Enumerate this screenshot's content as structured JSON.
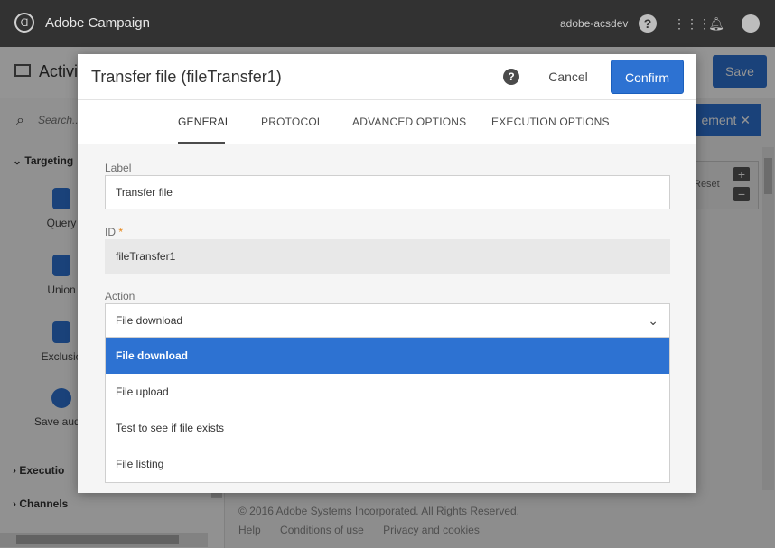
{
  "topbar": {
    "app_name": "Adobe Campaign",
    "user": "adobe-acsdev",
    "icons": [
      "adobe-logo-icon",
      "help-icon",
      "apps-grid-icon",
      "bell-icon",
      "avatar-icon"
    ]
  },
  "background": {
    "activity_title": "Activi",
    "save_label": "Save",
    "search_placeholder": "Search...",
    "categories": {
      "targeting": "Targeting",
      "execution": "Executio",
      "channels": "Channels"
    },
    "activities": [
      {
        "label": "Query",
        "icon": "query-icon"
      },
      {
        "label": "Union",
        "icon": "union-icon"
      },
      {
        "label": "Exclusio",
        "icon": "exclusion-icon"
      },
      {
        "label": "Save audie",
        "icon": "save-audience-icon"
      }
    ],
    "canvas_button": "ement",
    "zoom_reset": "Reset",
    "footer_copyright": "© 2016 Adobe Systems Incorporated. All Rights Reserved.",
    "footer_links": [
      "Help",
      "Conditions of use",
      "Privacy and cookies"
    ]
  },
  "dialog": {
    "title": "Transfer file (fileTransfer1)",
    "cancel_label": "Cancel",
    "confirm_label": "Confirm",
    "tabs": [
      "GENERAL",
      "PROTOCOL",
      "ADVANCED OPTIONS",
      "EXECUTION OPTIONS"
    ],
    "active_tab": "GENERAL",
    "form": {
      "label_label": "Label",
      "label_value": "Transfer file",
      "id_label": "ID",
      "id_required_mark": "*",
      "id_value": "fileTransfer1",
      "action_label": "Action",
      "action_value": "File download",
      "action_options": [
        "File download",
        "File upload",
        "Test to see if file exists",
        "File listing"
      ]
    }
  },
  "colors": {
    "accent": "#2d72d2",
    "topbar": "#323232",
    "required": "#e68619"
  }
}
